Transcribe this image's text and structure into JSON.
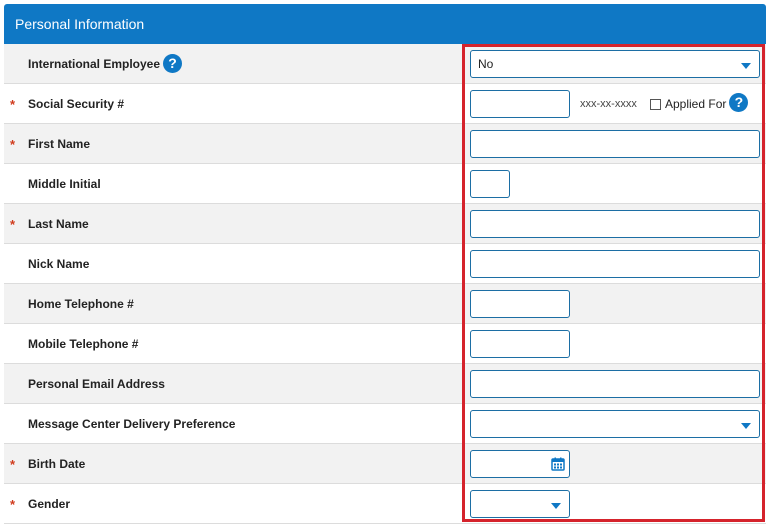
{
  "header": {
    "title": "Personal Information"
  },
  "fields": {
    "international_employee": {
      "label": "International Employee",
      "value": "No"
    },
    "ssn": {
      "label": "Social Security #",
      "value": "",
      "format_hint": "xxx-xx-xxxx",
      "applied_for_label": "Applied For"
    },
    "first_name": {
      "label": "First Name",
      "value": ""
    },
    "middle_initial": {
      "label": "Middle Initial",
      "value": ""
    },
    "last_name": {
      "label": "Last Name",
      "value": ""
    },
    "nick_name": {
      "label": "Nick Name",
      "value": ""
    },
    "home_phone": {
      "label": "Home Telephone #",
      "value": ""
    },
    "mobile_phone": {
      "label": "Mobile Telephone #",
      "value": ""
    },
    "email": {
      "label": "Personal Email Address",
      "value": ""
    },
    "message_pref": {
      "label": "Message Center Delivery Preference",
      "value": ""
    },
    "birth_date": {
      "label": "Birth Date",
      "value": ""
    },
    "gender": {
      "label": "Gender",
      "value": ""
    }
  },
  "required_marker": "*",
  "help_icon": "?",
  "colors": {
    "header": "#0f78c5",
    "required": "#d03b1d",
    "highlight": "#d5232c"
  }
}
